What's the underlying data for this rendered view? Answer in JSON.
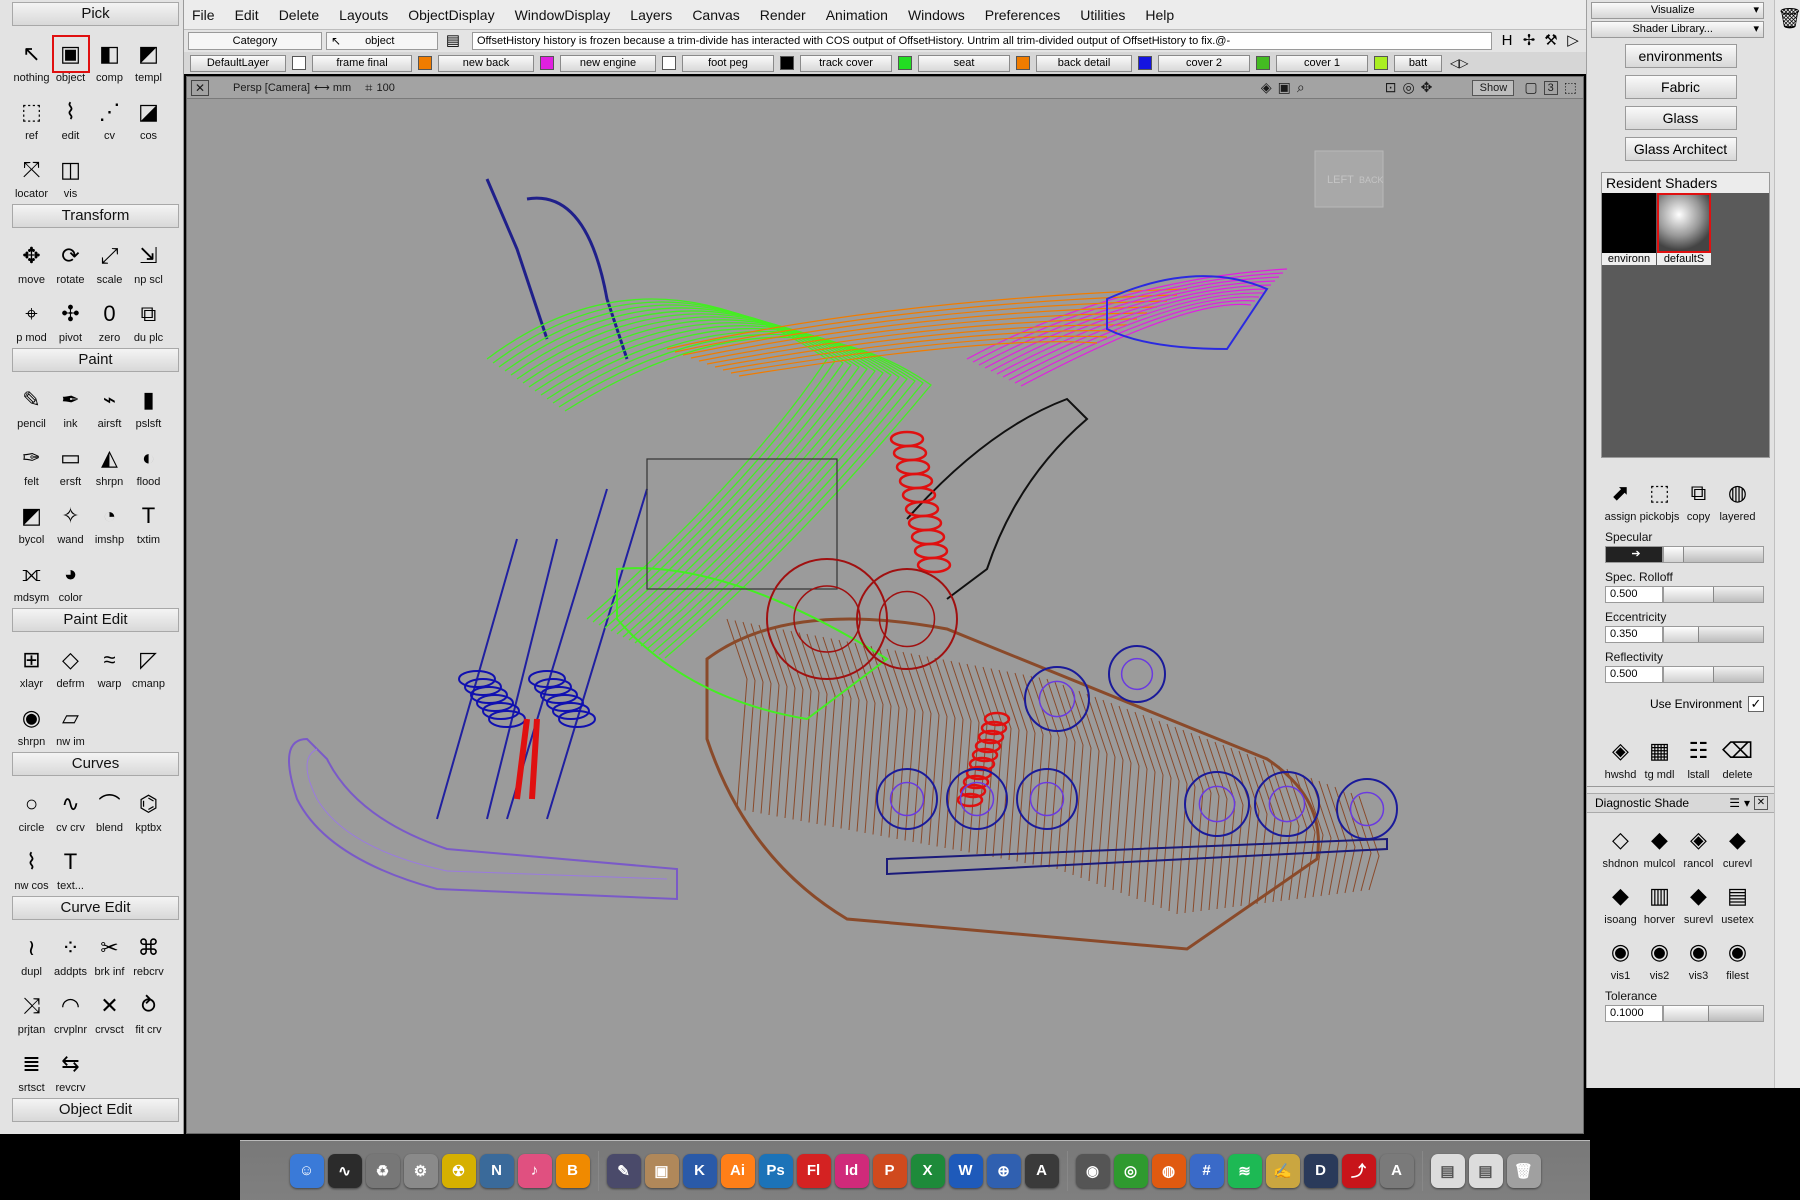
{
  "palette": {
    "sections": [
      {
        "title": "Pick",
        "tools": [
          {
            "label": "nothing",
            "icon": "cursor-icon"
          },
          {
            "label": "object",
            "icon": "cube-select-icon",
            "active": true
          },
          {
            "label": "comp",
            "icon": "component-icon"
          },
          {
            "label": "templ",
            "icon": "template-icon"
          },
          {
            "label": "ref",
            "icon": "reference-icon"
          },
          {
            "label": "edit",
            "icon": "edit-point-icon"
          },
          {
            "label": "cv",
            "icon": "cv-icon"
          },
          {
            "label": "cos",
            "icon": "cos-icon"
          },
          {
            "label": "locator",
            "icon": "locator-icon"
          },
          {
            "label": "vis",
            "icon": "visible-icon"
          }
        ]
      },
      {
        "title": "Transform",
        "tools": [
          {
            "label": "move",
            "icon": "move-icon"
          },
          {
            "label": "rotate",
            "icon": "rotate-icon"
          },
          {
            "label": "scale",
            "icon": "scale-icon"
          },
          {
            "label": "np scl",
            "icon": "nonprop-scale-icon"
          },
          {
            "label": "p mod",
            "icon": "pivot-modify-icon"
          },
          {
            "label": "pivot",
            "icon": "pivot-icon"
          },
          {
            "label": "zero",
            "icon": "zero-icon"
          },
          {
            "label": "du plc",
            "icon": "duplicate-place-icon"
          }
        ]
      },
      {
        "title": "Paint",
        "tools": [
          {
            "label": "pencil",
            "icon": "pencil-icon"
          },
          {
            "label": "ink",
            "icon": "ink-icon"
          },
          {
            "label": "airsft",
            "icon": "airbrush-icon"
          },
          {
            "label": "pslsft",
            "icon": "pastel-icon"
          },
          {
            "label": "felt",
            "icon": "felt-pen-icon"
          },
          {
            "label": "ersft",
            "icon": "eraser-icon"
          },
          {
            "label": "shrpn",
            "icon": "sharpen-icon"
          },
          {
            "label": "flood",
            "icon": "flood-fill-icon"
          },
          {
            "label": "bycol",
            "icon": "by-color-icon"
          },
          {
            "label": "wand",
            "icon": "magic-wand-icon"
          },
          {
            "label": "imshp",
            "icon": "image-shape-icon"
          },
          {
            "label": "txtim",
            "icon": "text-image-icon"
          },
          {
            "label": "mdsym",
            "icon": "mode-symmetry-icon"
          },
          {
            "label": "color",
            "icon": "color-wheel-icon"
          }
        ]
      },
      {
        "title": "Paint Edit",
        "tools": [
          {
            "label": "xlayr",
            "icon": "transform-layer-icon"
          },
          {
            "label": "defrm",
            "icon": "deform-icon"
          },
          {
            "label": "warp",
            "icon": "warp-icon"
          },
          {
            "label": "cmanp",
            "icon": "canvas-manip-icon"
          },
          {
            "label": "shrpn",
            "icon": "sharpen-region-icon"
          },
          {
            "label": "nw im",
            "icon": "new-image-icon"
          }
        ]
      },
      {
        "title": "Curves",
        "tools": [
          {
            "label": "circle",
            "icon": "circle-icon"
          },
          {
            "label": "cv crv",
            "icon": "cv-curve-icon"
          },
          {
            "label": "blend",
            "icon": "blend-curve-icon"
          },
          {
            "label": "kptbx",
            "icon": "keypoint-box-icon"
          },
          {
            "label": "nw cos",
            "icon": "new-cos-icon"
          },
          {
            "label": "text...",
            "icon": "text-icon"
          }
        ]
      },
      {
        "title": "Curve Edit",
        "tools": [
          {
            "label": "dupl",
            "icon": "duplicate-curve-icon"
          },
          {
            "label": "addpts",
            "icon": "add-points-icon"
          },
          {
            "label": "brk inf",
            "icon": "break-inflection-icon"
          },
          {
            "label": "rebcrv",
            "icon": "rebuild-curve-icon"
          },
          {
            "label": "prjtan",
            "icon": "project-tangent-icon"
          },
          {
            "label": "crvplnr",
            "icon": "curve-planar-icon"
          },
          {
            "label": "crvsct",
            "icon": "curve-section-icon"
          },
          {
            "label": "fit crv",
            "icon": "fit-curve-icon"
          },
          {
            "label": "srtsct",
            "icon": "sort-section-icon"
          },
          {
            "label": "revcrv",
            "icon": "reverse-curve-icon"
          }
        ]
      }
    ],
    "next_section": "Object Edit"
  },
  "menubar": [
    "File",
    "Edit",
    "Delete",
    "Layouts",
    "ObjectDisplay",
    "WindowDisplay",
    "Layers",
    "Canvas",
    "Render",
    "Animation",
    "Windows",
    "Preferences",
    "Utilities",
    "Help"
  ],
  "promptbar": {
    "category_label": "Category",
    "tool_label": "object",
    "message": "OffsetHistory history is frozen because a trim-divide has interacted with COS output of OffsetHistory.  Untrim all trim-divided output of OffsetHistory to fix.@-"
  },
  "layers": [
    {
      "name": "DefaultLayer",
      "color": "#ffffff"
    },
    {
      "name": "frame final",
      "color": "#f07c00"
    },
    {
      "name": "new back",
      "color": "#e020e0"
    },
    {
      "name": "new engine",
      "color": "#ffffff"
    },
    {
      "name": "foot peg",
      "color": "#000000"
    },
    {
      "name": "track cover",
      "color": "#22dd22"
    },
    {
      "name": "seat",
      "color": "#f07c00"
    },
    {
      "name": "back detail",
      "color": "#1414e0"
    },
    {
      "name": "cover 2",
      "color": "#44bb22"
    },
    {
      "name": "cover 1",
      "color": "#aaee22"
    },
    {
      "name": "batt",
      "color": "#888888"
    }
  ],
  "viewport": {
    "camera_label": "Persp [Camera]",
    "units": "mm",
    "grid_value": "100",
    "show_button": "Show",
    "view_cube_left": "LEFT",
    "view_cube_back": "BACK"
  },
  "rightpanel": {
    "visualize_label": "Visualize",
    "shader_library_label": "Shader Library...",
    "library_buttons": [
      "environments",
      "Fabric",
      "Glass",
      "Glass Architect"
    ],
    "resident_shaders_label": "Resident Shaders",
    "shader_swatches": [
      {
        "label": "environn",
        "color": "#000000"
      },
      {
        "label": "defaultS",
        "color": "#aaaaaa"
      }
    ],
    "shader_actions": [
      {
        "label": "assign",
        "icon": "assign-shader-icon"
      },
      {
        "label": "pickobjs",
        "icon": "pick-objects-icon"
      },
      {
        "label": "copy",
        "icon": "copy-shader-icon"
      },
      {
        "label": "layered",
        "icon": "layered-shader-icon"
      }
    ],
    "sliders": [
      {
        "label": "Specular",
        "value": "",
        "fill": 0.2
      },
      {
        "label": "Spec. Rolloff",
        "value": "0.500",
        "fill": 0.5
      },
      {
        "label": "Eccentricity",
        "value": "0.350",
        "fill": 0.35
      },
      {
        "label": "Reflectivity",
        "value": "0.500",
        "fill": 0.5
      }
    ],
    "use_environment_label": "Use Environment",
    "use_environment_checked": true,
    "shader_tools": [
      {
        "label": "hwshd",
        "icon": "hardware-shade-icon"
      },
      {
        "label": "tg mdl",
        "icon": "toggle-model-icon"
      },
      {
        "label": "lstall",
        "icon": "list-all-icon"
      },
      {
        "label": "delete",
        "icon": "delete-shader-icon"
      }
    ],
    "diagnostic_title": "Diagnostic Shade",
    "diagnostic_tools": [
      {
        "label": "shdnon",
        "icon": "shade-none-icon"
      },
      {
        "label": "mulcol",
        "icon": "multi-color-icon"
      },
      {
        "label": "rancol",
        "icon": "random-color-icon"
      },
      {
        "label": "curevl",
        "icon": "curvature-eval-icon"
      },
      {
        "label": "isoang",
        "icon": "iso-angle-icon"
      },
      {
        "label": "horver",
        "icon": "horizontal-vertical-icon"
      },
      {
        "label": "surevl",
        "icon": "surface-eval-icon"
      },
      {
        "label": "usetex",
        "icon": "use-texture-icon"
      },
      {
        "label": "vis1",
        "icon": "visual-1-icon"
      },
      {
        "label": "vis2",
        "icon": "visual-2-icon"
      },
      {
        "label": "vis3",
        "icon": "visual-3-icon"
      },
      {
        "label": "filest",
        "icon": "file-style-icon"
      }
    ],
    "tolerance_label": "Tolerance",
    "tolerance_value": "0.1000"
  },
  "dock": [
    {
      "name": "finder",
      "text": "☺",
      "color": "#3a7ad8"
    },
    {
      "name": "activity-monitor",
      "text": "∿",
      "color": "#2b2b2b"
    },
    {
      "name": "trash-utility",
      "text": "♻",
      "color": "#777777"
    },
    {
      "name": "system-preferences",
      "text": "⚙",
      "color": "#8a8a8a"
    },
    {
      "name": "radiation-app",
      "text": "☢",
      "color": "#d6b000"
    },
    {
      "name": "ntfs-app",
      "text": "N",
      "color": "#3a6a9a"
    },
    {
      "name": "itunes",
      "text": "♪",
      "color": "#e05080"
    },
    {
      "name": "ibooks",
      "text": "B",
      "color": "#f08a00"
    },
    {
      "name": "sketchbook",
      "text": "✎",
      "color": "#4a4a6a"
    },
    {
      "name": "preview",
      "text": "▣",
      "color": "#b0885a"
    },
    {
      "name": "keynote",
      "text": "K",
      "color": "#2a5aa8"
    },
    {
      "name": "illustrator",
      "text": "Ai",
      "color": "#ff7f18"
    },
    {
      "name": "photoshop",
      "text": "Ps",
      "color": "#1c73b8"
    },
    {
      "name": "flash",
      "text": "Fl",
      "color": "#d42222"
    },
    {
      "name": "indesign",
      "text": "Id",
      "color": "#d02a7a"
    },
    {
      "name": "powerpoint",
      "text": "P",
      "color": "#d04a1e"
    },
    {
      "name": "excel",
      "text": "X",
      "color": "#1e8a3a"
    },
    {
      "name": "word",
      "text": "W",
      "color": "#1e5aba"
    },
    {
      "name": "keyshot",
      "text": "⊕",
      "color": "#3060b0"
    },
    {
      "name": "alias",
      "text": "A",
      "color": "#3a3a3a"
    },
    {
      "name": "camera-app",
      "text": "◉",
      "color": "#555555"
    },
    {
      "name": "chrome",
      "text": "◎",
      "color": "#2f9a2f"
    },
    {
      "name": "firefox",
      "text": "◍",
      "color": "#e05a10"
    },
    {
      "name": "network-app",
      "text": "#",
      "color": "#3a6ac8"
    },
    {
      "name": "spotify",
      "text": "≋",
      "color": "#1db954"
    },
    {
      "name": "sticky-notes",
      "text": "✍",
      "color": "#caa640"
    },
    {
      "name": "diablo",
      "text": "D",
      "color": "#2a3a5a"
    },
    {
      "name": "acrobat",
      "text": "⤴",
      "color": "#c8141a"
    },
    {
      "name": "autocad",
      "text": "A",
      "color": "#7a7a7a"
    },
    {
      "name": "document-1",
      "text": "▤",
      "color": "#dcdcdc"
    },
    {
      "name": "document-2",
      "text": "▤",
      "color": "#dcdcdc"
    },
    {
      "name": "trash",
      "text": "🗑",
      "color": "#a0a0a0"
    }
  ]
}
